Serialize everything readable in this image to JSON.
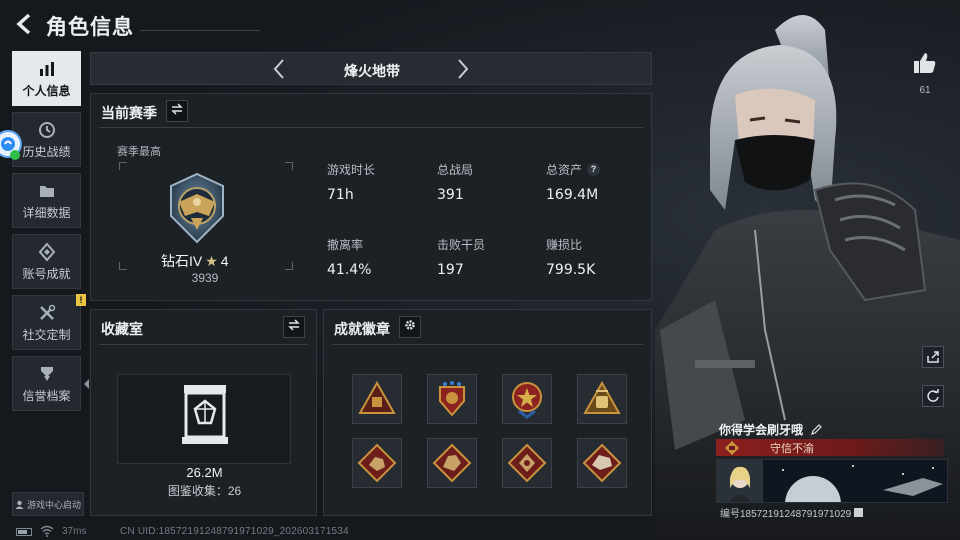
{
  "header": {
    "title": "角色信息"
  },
  "sidebar": {
    "items": [
      {
        "label": "个人信息",
        "icon": "bar-chart-icon",
        "active": true
      },
      {
        "label": "历史战绩",
        "icon": "clock-icon"
      },
      {
        "label": "详细数据",
        "icon": "folder-icon"
      },
      {
        "label": "账号成就",
        "icon": "diamond-badge-icon"
      },
      {
        "label": "社交定制",
        "icon": "tools-icon",
        "badge": "!"
      },
      {
        "label": "信誉档案",
        "icon": "shield-award-icon"
      }
    ],
    "game_center": "游戏中心启动"
  },
  "season": {
    "name": "烽火地带"
  },
  "current_season": {
    "title": "当前赛季",
    "best_label": "赛季最高",
    "rank_name": "钻石IV",
    "rank_stars": "4",
    "rank_score": "3939",
    "stats": [
      {
        "label": "游戏时长",
        "value": "71h"
      },
      {
        "label": "总战局",
        "value": "391"
      },
      {
        "label": "总资产",
        "value": "169.4M",
        "help": "?"
      },
      {
        "label": "撤离率",
        "value": "41.4%"
      },
      {
        "label": "击败干员",
        "value": "197"
      },
      {
        "label": "赚损比",
        "value": "799.5K"
      }
    ]
  },
  "collection": {
    "title": "收藏室",
    "value": "26.2M",
    "count_text": "图鉴收集：26"
  },
  "achievements": {
    "title": "成就徽章"
  },
  "likes": {
    "count": "61"
  },
  "player": {
    "name": "你得学会刷牙哦",
    "reputation": "守信不渝",
    "id_text": "编号18572191248791971029"
  },
  "footer": {
    "ping": "37ms",
    "uid": "CN UID:18572191248791971029_202603171534"
  },
  "colors": {
    "accent": "#e6e9ec",
    "reputation_bg": "#8d1f1f",
    "badge_gold": "#c9923d"
  }
}
